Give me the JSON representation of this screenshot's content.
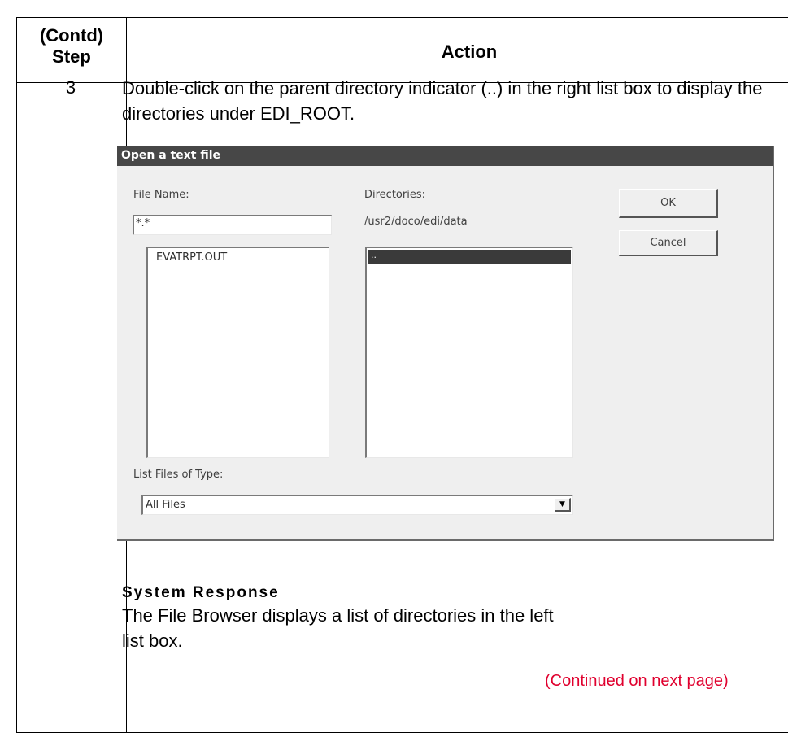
{
  "table": {
    "header_step": "(Contd)\nStep",
    "header_action": "Action",
    "step_number": "3",
    "action_text": "Double-click on the parent directory indicator (..) in the right list box to display the directories under EDI_ROOT."
  },
  "dialog": {
    "title": "Open a text file",
    "file_name_label": "File Name:",
    "file_name_value": "*.*",
    "directories_label": "Directories:",
    "directory_path": "/usr2/doco/edi/data",
    "files": [
      "EVATRPT.OUT"
    ],
    "directories": [
      ".."
    ],
    "ok_label": "OK",
    "cancel_label": "Cancel",
    "file_type_label": "List Files of Type:",
    "file_type_value": "All Files",
    "dropdown_icon": "chevron-down-icon"
  },
  "response": {
    "heading": "System Response",
    "text": "The File Browser displays a list of directories in the left list box.",
    "continued": "(Continued on next page)"
  }
}
